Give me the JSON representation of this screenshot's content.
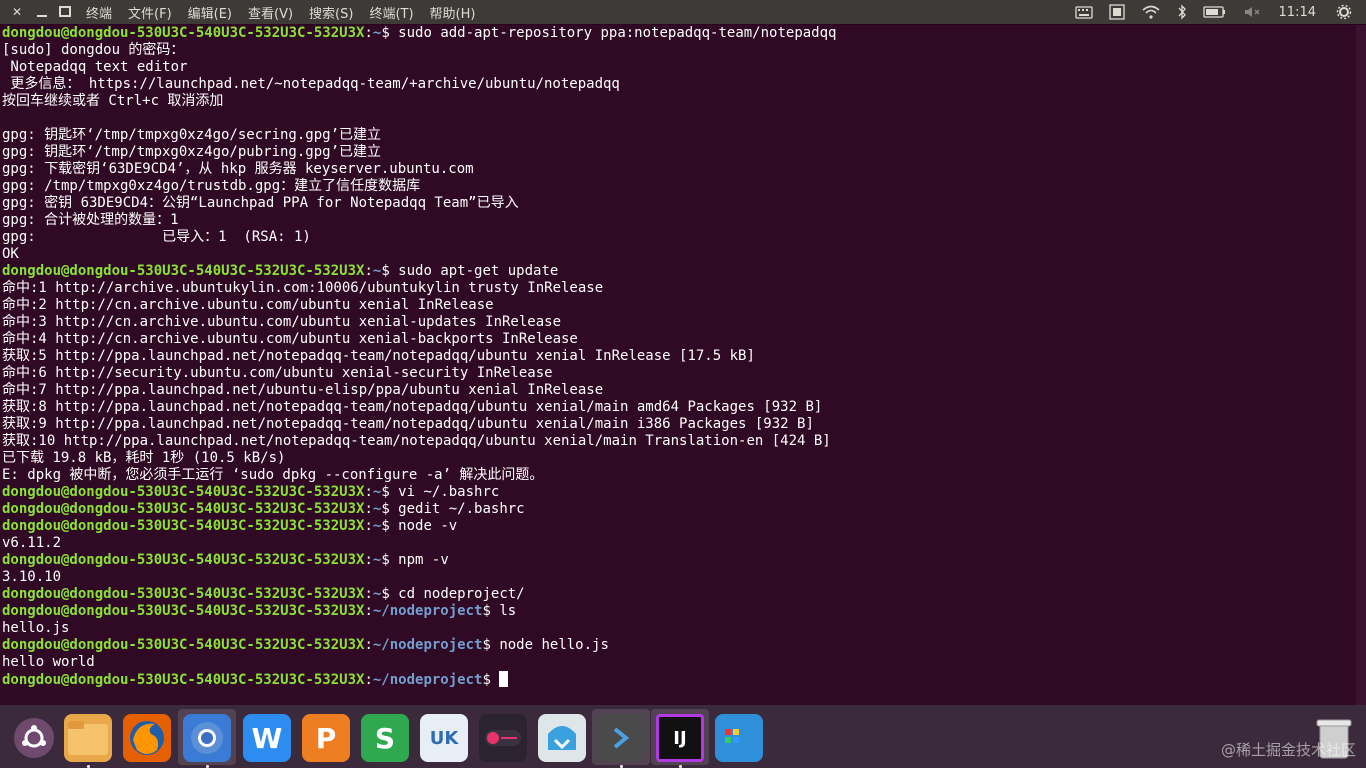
{
  "menubar": {
    "items": [
      "终端",
      "文件(F)",
      "编辑(E)",
      "查看(V)",
      "搜索(S)",
      "终端(T)",
      "帮助(H)"
    ],
    "clock": "11:14"
  },
  "terminal": {
    "lines": [
      {
        "prompt": "dongdou@dongdou-530U3C-540U3C-532U3C-532U3X",
        "path": "~",
        "cmd": " sudo add-apt-repository ppa:notepadqq-team/notepadqq"
      },
      {
        "text": "[sudo] dongdou 的密码："
      },
      {
        "text": " Notepadqq text editor"
      },
      {
        "text": " 更多信息： https://launchpad.net/~notepadqq-team/+archive/ubuntu/notepadqq"
      },
      {
        "text": "按回车继续或者 Ctrl+c 取消添加"
      },
      {
        "text": ""
      },
      {
        "text": "gpg: 钥匙环‘/tmp/tmpxg0xz4go/secring.gpg’已建立"
      },
      {
        "text": "gpg: 钥匙环‘/tmp/tmpxg0xz4go/pubring.gpg’已建立"
      },
      {
        "text": "gpg: 下载密钥‘63DE9CD4’，从 hkp 服务器 keyserver.ubuntu.com"
      },
      {
        "text": "gpg: /tmp/tmpxg0xz4go/trustdb.gpg：建立了信任度数据库"
      },
      {
        "text": "gpg: 密钥 63DE9CD4：公钥“Launchpad PPA for Notepadqq Team”已导入"
      },
      {
        "text": "gpg: 合计被处理的数量：1"
      },
      {
        "text": "gpg:               已导入：1  (RSA: 1)"
      },
      {
        "text": "OK"
      },
      {
        "prompt": "dongdou@dongdou-530U3C-540U3C-532U3C-532U3X",
        "path": "~",
        "cmd": " sudo apt-get update"
      },
      {
        "text": "命中:1 http://archive.ubuntukylin.com:10006/ubuntukylin trusty InRelease"
      },
      {
        "text": "命中:2 http://cn.archive.ubuntu.com/ubuntu xenial InRelease"
      },
      {
        "text": "命中:3 http://cn.archive.ubuntu.com/ubuntu xenial-updates InRelease"
      },
      {
        "text": "命中:4 http://cn.archive.ubuntu.com/ubuntu xenial-backports InRelease"
      },
      {
        "text": "获取:5 http://ppa.launchpad.net/notepadqq-team/notepadqq/ubuntu xenial InRelease [17.5 kB]"
      },
      {
        "text": "命中:6 http://security.ubuntu.com/ubuntu xenial-security InRelease"
      },
      {
        "text": "命中:7 http://ppa.launchpad.net/ubuntu-elisp/ppa/ubuntu xenial InRelease"
      },
      {
        "text": "获取:8 http://ppa.launchpad.net/notepadqq-team/notepadqq/ubuntu xenial/main amd64 Packages [932 B]"
      },
      {
        "text": "获取:9 http://ppa.launchpad.net/notepadqq-team/notepadqq/ubuntu xenial/main i386 Packages [932 B]"
      },
      {
        "text": "获取:10 http://ppa.launchpad.net/notepadqq-team/notepadqq/ubuntu xenial/main Translation-en [424 B]"
      },
      {
        "text": "已下载 19.8 kB，耗时 1秒 (10.5 kB/s)"
      },
      {
        "text": "E: dpkg 被中断，您必须手工运行 ‘sudo dpkg --configure -a’ 解决此问题。"
      },
      {
        "prompt": "dongdou@dongdou-530U3C-540U3C-532U3C-532U3X",
        "path": "~",
        "cmd": " vi ~/.bashrc"
      },
      {
        "prompt": "dongdou@dongdou-530U3C-540U3C-532U3C-532U3X",
        "path": "~",
        "cmd": " gedit ~/.bashrc"
      },
      {
        "prompt": "dongdou@dongdou-530U3C-540U3C-532U3C-532U3X",
        "path": "~",
        "cmd": " node -v"
      },
      {
        "text": "v6.11.2"
      },
      {
        "prompt": "dongdou@dongdou-530U3C-540U3C-532U3C-532U3X",
        "path": "~",
        "cmd": " npm -v"
      },
      {
        "text": "3.10.10"
      },
      {
        "prompt": "dongdou@dongdou-530U3C-540U3C-532U3C-532U3X",
        "path": "~",
        "cmd": " cd nodeproject/"
      },
      {
        "prompt": "dongdou@dongdou-530U3C-540U3C-532U3C-532U3X",
        "path": "~/nodeproject",
        "cmd": " ls"
      },
      {
        "text": "hello.js"
      },
      {
        "prompt": "dongdou@dongdou-530U3C-540U3C-532U3C-532U3X",
        "path": "~/nodeproject",
        "cmd": " node hello.js"
      },
      {
        "text": "hello world"
      },
      {
        "prompt": "dongdou@dongdou-530U3C-540U3C-532U3C-532U3X",
        "path": "~/nodeproject",
        "cmd": " ",
        "cursor": true
      }
    ]
  },
  "dock": {
    "apps": [
      {
        "name": "ubuntu-dash",
        "label": "",
        "color": "#6f4a6e"
      },
      {
        "name": "files",
        "label": "",
        "color": "#e9a84a"
      },
      {
        "name": "firefox",
        "label": "",
        "color": "#e66000"
      },
      {
        "name": "chromium",
        "label": "",
        "color": "#3a7bd5"
      },
      {
        "name": "wps-writer",
        "label": "W",
        "color": "#2d8cf0"
      },
      {
        "name": "wps-presentation",
        "label": "P",
        "color": "#ef7d22"
      },
      {
        "name": "wps-spreadsheet",
        "label": "S",
        "color": "#2fa84f"
      },
      {
        "name": "ubuntukylin-store",
        "label": "UK",
        "color": "#e8eef5"
      },
      {
        "name": "recorder",
        "label": "",
        "color": "#2b2430"
      },
      {
        "name": "software-updater",
        "label": "",
        "color": "#dfe6ea"
      },
      {
        "name": "terminal",
        "label": "",
        "color": "#4a4a4a"
      },
      {
        "name": "intellij-idea",
        "label": "IJ",
        "color": "#111111"
      },
      {
        "name": "workspace-switcher",
        "label": "",
        "color": "#2f8fd8"
      },
      {
        "name": "trash",
        "label": "",
        "color": "#d9d9d9"
      }
    ]
  },
  "watermark": "@稀土掘金技术社区",
  "colors": {
    "terminal_bg": "#300a24",
    "prompt_user": "#8ae234",
    "prompt_path": "#729fcf",
    "panel": "#3c3b37"
  }
}
